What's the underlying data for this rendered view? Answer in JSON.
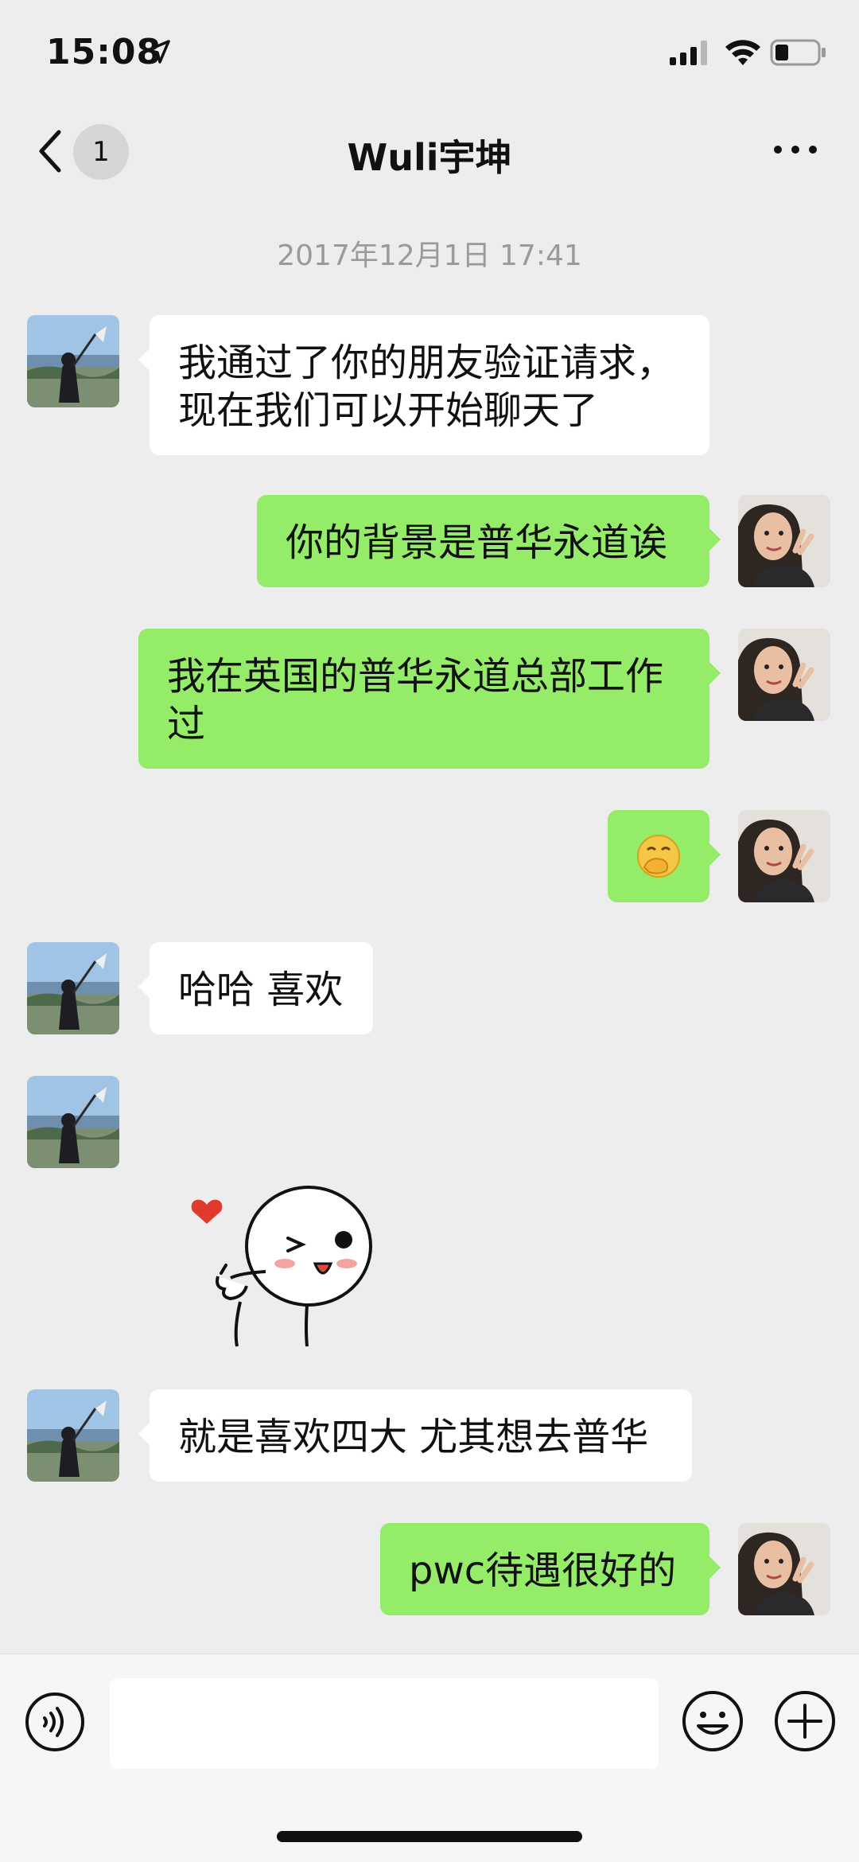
{
  "status_bar": {
    "time": "15:08"
  },
  "nav": {
    "back_badge": "1",
    "title": "Wuli宇坤"
  },
  "chat": {
    "timestamp": "2017年12月1日 17:41",
    "messages": [
      {
        "from": "other",
        "text": "我通过了你的朋友验证请求，现在我们可以开始聊天了"
      },
      {
        "from": "me",
        "text": "你的背景是普华永道诶"
      },
      {
        "from": "me",
        "text": "我在英国的普华永道总部工作过"
      },
      {
        "from": "me",
        "emoji": "face-with-hand-over-mouth"
      },
      {
        "from": "other",
        "text": "哈哈 喜欢"
      },
      {
        "from": "other",
        "sticker": "wink-heart-sticker"
      },
      {
        "from": "other",
        "text": "就是喜欢四大 尤其想去普华"
      },
      {
        "from": "me",
        "text": "pwc待遇很好的"
      }
    ]
  },
  "input_bar": {
    "placeholder": ""
  },
  "colors": {
    "background": "#ededed",
    "bubble_me": "#95ec69",
    "bubble_other": "#ffffff"
  }
}
